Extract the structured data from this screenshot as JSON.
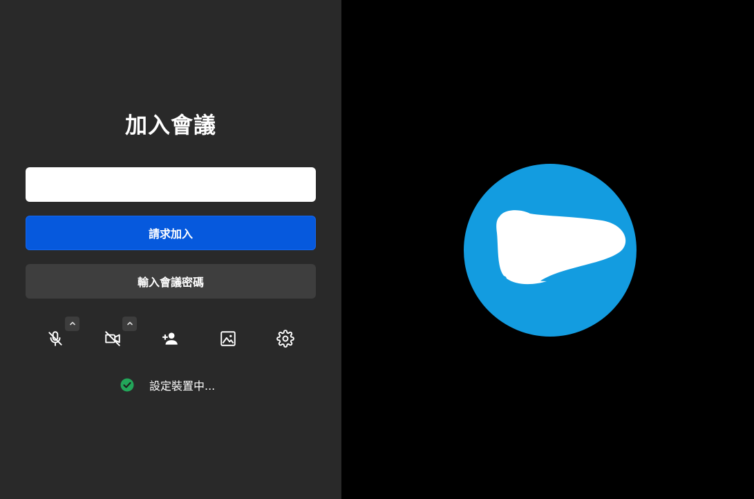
{
  "join": {
    "title": "加入會議",
    "name_input_value": "",
    "name_input_placeholder": "",
    "request_join_label": "請求加入",
    "enter_password_label": "輸入會議密碼"
  },
  "toolbar": {
    "items": [
      {
        "name": "mic-off-icon"
      },
      {
        "name": "camera-off-icon"
      },
      {
        "name": "add-person-icon"
      },
      {
        "name": "image-icon"
      },
      {
        "name": "gear-icon"
      }
    ]
  },
  "status": {
    "text": "設定裝置中...",
    "icon": "check-circle-icon"
  },
  "colors": {
    "left_panel_bg": "#292929",
    "right_panel_bg": "#000000",
    "primary_button": "#0659dd",
    "secondary_button": "#3e3e3e",
    "avatar_bg": "#139ce0",
    "status_check": "#22a559"
  }
}
